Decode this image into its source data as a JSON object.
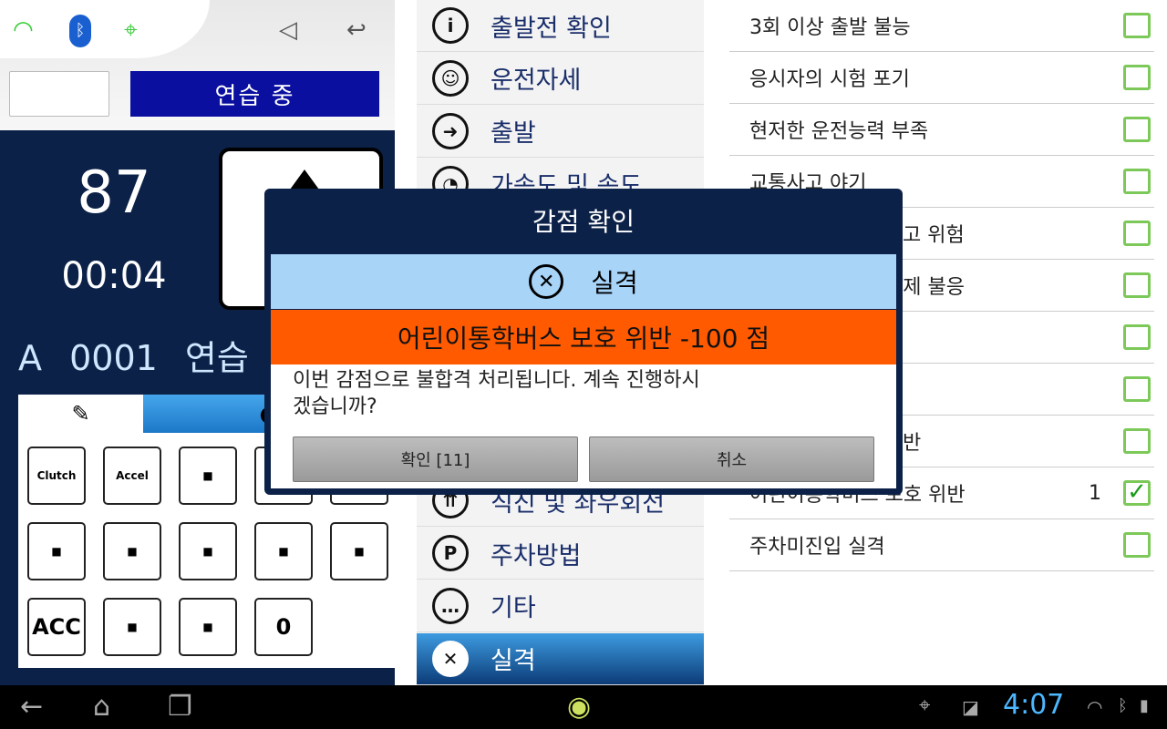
{
  "status_icons": [
    "wifi-icon",
    "bluetooth-icon",
    "gps-icon",
    "speaker-icon",
    "back-icon"
  ],
  "header": {
    "mode_label": "연습 중"
  },
  "dashboard": {
    "score": "87",
    "timer": "00:04",
    "course": "A",
    "number": "0001",
    "mode": "연습"
  },
  "panel": {
    "cells": [
      "Clutch",
      "Accel",
      "",
      "",
      "",
      "",
      "",
      "",
      "",
      "",
      "ACC",
      "",
      "",
      "0"
    ]
  },
  "menu": {
    "items": [
      {
        "label": "출발전 확인",
        "icon": "info-icon"
      },
      {
        "label": "운전자세",
        "icon": "driver-icon"
      },
      {
        "label": "출발",
        "icon": "car-start-icon"
      },
      {
        "label": "가속도 및 속도",
        "icon": "speedometer-icon"
      },
      {
        "label": "",
        "icon": ""
      },
      {
        "label": "",
        "icon": ""
      },
      {
        "label": "",
        "icon": ""
      },
      {
        "label": "",
        "icon": ""
      },
      {
        "label": "",
        "icon": ""
      },
      {
        "label": "직진 및 좌우회전",
        "icon": "intersection-icon"
      },
      {
        "label": "주차방법",
        "icon": "parking-icon"
      },
      {
        "label": "기타",
        "icon": "chat-icon"
      },
      {
        "label": "실격",
        "icon": "disqualify-icon",
        "selected": true
      }
    ]
  },
  "criteria": [
    {
      "label": "3회 이상 출발 불능",
      "checked": false
    },
    {
      "label": "응시자의 시험 포기",
      "checked": false
    },
    {
      "label": "현저한 운전능력 부족",
      "checked": false
    },
    {
      "label": "교통사고 야기",
      "checked": false
    },
    {
      "label": "고 위험",
      "checked": false
    },
    {
      "label": "통제 불응",
      "checked": false
    },
    {
      "label": "",
      "checked": false
    },
    {
      "label": "",
      "checked": false
    },
    {
      "label": "반",
      "checked": false
    },
    {
      "label": "어린이통학버스 보호 위반",
      "count": "1",
      "checked": true
    },
    {
      "label": "주차미진입 실격",
      "checked": false
    }
  ],
  "dialog": {
    "title": "감점 확인",
    "category": "실격",
    "penalty": "어린이통학버스 보호 위반  -100 점",
    "message": "이번 감점으로 불합격 처리됩니다. 계속 진행하시겠습니까?",
    "confirm": "확인 [11]",
    "cancel": "취소"
  },
  "navbar": {
    "time": "4:07"
  },
  "colors": {
    "navy": "#0b2148",
    "practice": "#0a0fa0",
    "category_bg": "#a8d4f8",
    "penalty_bg": "#ff5a00",
    "check": "#7cc95a"
  }
}
